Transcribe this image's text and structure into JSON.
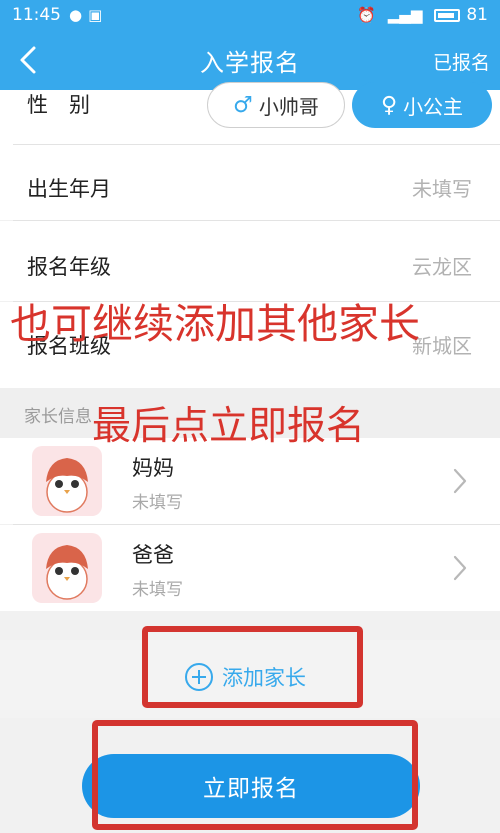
{
  "status_bar": {
    "time": "11:45",
    "battery": "81"
  },
  "nav": {
    "back_icon": "chevron-left-icon",
    "title": "入学报名",
    "right_link": "已报名"
  },
  "gender": {
    "label": "性　别",
    "male_label": "小帅哥",
    "female_label": "小公主",
    "selected": "female"
  },
  "form": {
    "birth": {
      "label": "出生年月",
      "value": "未填写"
    },
    "grade": {
      "label": "报名年级",
      "value": "云龙区"
    },
    "class": {
      "label": "报名班级",
      "value": "新城区"
    }
  },
  "parent_section": {
    "header": "家长信息"
  },
  "parents": [
    {
      "name": "妈妈",
      "status": "未填写"
    },
    {
      "name": "爸爸",
      "status": "未填写"
    }
  ],
  "add_parent_label": "添加家长",
  "submit_label": "立即报名",
  "annotations": {
    "line1": "也可继续添加其他家长",
    "line2": "最后点立即报名"
  },
  "colors": {
    "primary": "#37a9ec",
    "submit": "#1c95e6",
    "annotation": "#d8342c"
  }
}
